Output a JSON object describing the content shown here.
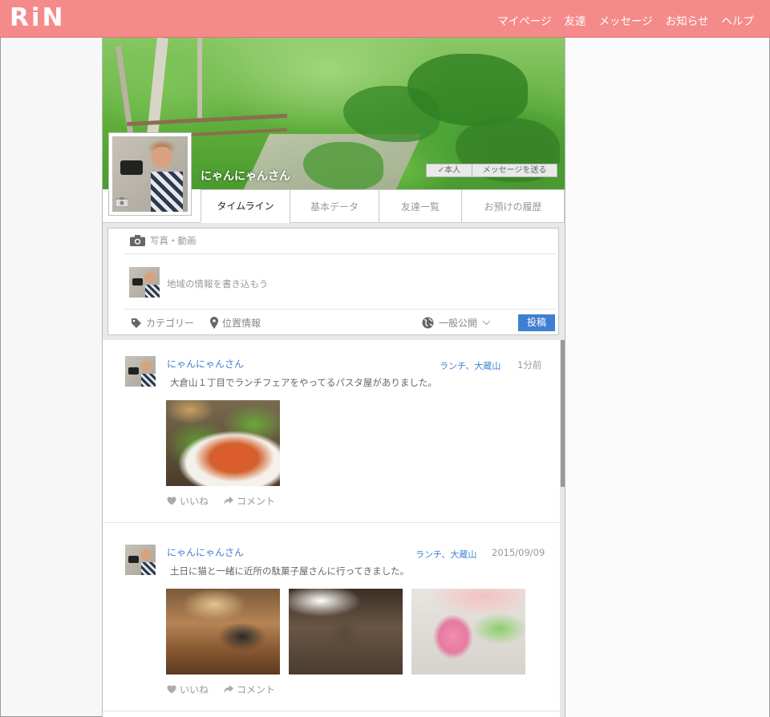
{
  "header": {
    "logo": "RiN",
    "nav": [
      "マイページ",
      "友達",
      "メッセージ",
      "お知らせ",
      "ヘルプ"
    ]
  },
  "profile": {
    "name": "にゃんにゃんさん",
    "self_badge": "✓本人",
    "message_button": "メッセージを送る"
  },
  "tabs": [
    "タイムライン",
    "基本データ",
    "友達一覧",
    "お預けの履歴"
  ],
  "composer": {
    "media_label": "写真・動画",
    "placeholder": "地域の情報を書き込もう",
    "category_label": "カテゴリー",
    "location_label": "位置情報",
    "visibility": "一般公開",
    "submit": "投稿"
  },
  "posts": [
    {
      "author": "にゃんにゃんさん",
      "tags": "ランチ、大蔵山",
      "time": "1分前",
      "text": "大倉山１丁目でランチフェアをやってるパスタ屋がありました。",
      "like": "いいね",
      "comment": "コメント"
    },
    {
      "author": "にゃんにゃんさん",
      "tags": "ランチ、大蔵山",
      "time": "2015/09/09",
      "text": "土日に猫と一緒に近所の駄菓子屋さんに行ってきました。",
      "like": "いいね",
      "comment": "コメント"
    }
  ],
  "colors": {
    "header_bg": "#f58a8a",
    "link": "#3f7fd1",
    "submit_bg": "#3f7fd1"
  }
}
